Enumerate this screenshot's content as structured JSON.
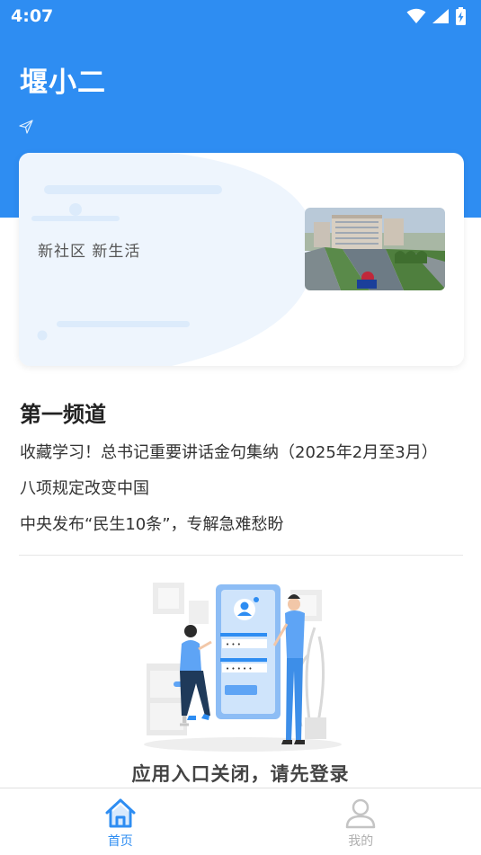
{
  "status_bar": {
    "time": "4:07",
    "icons": [
      "wifi-icon",
      "signal-icon",
      "battery-charging-icon"
    ]
  },
  "header": {
    "app_title": "堰小二",
    "accent_color": "#2e8df2",
    "share_icon": "send-icon"
  },
  "banner": {
    "slogan": "新社区 新生活",
    "photo": "town-street-photo"
  },
  "channel": {
    "title": "第一频道",
    "items": [
      "收藏学习！总书记重要讲话金句集纳（2025年2月至3月）",
      "八项规定改变中国",
      "中央发布“民生10条”，专解急难愁盼"
    ]
  },
  "login_notice": {
    "text": "应用入口关闭，请先登录"
  },
  "bottom_nav": {
    "items": [
      {
        "label": "首页",
        "icon": "home-icon",
        "active": true
      },
      {
        "label": "我的",
        "icon": "user-icon",
        "active": false
      }
    ]
  }
}
